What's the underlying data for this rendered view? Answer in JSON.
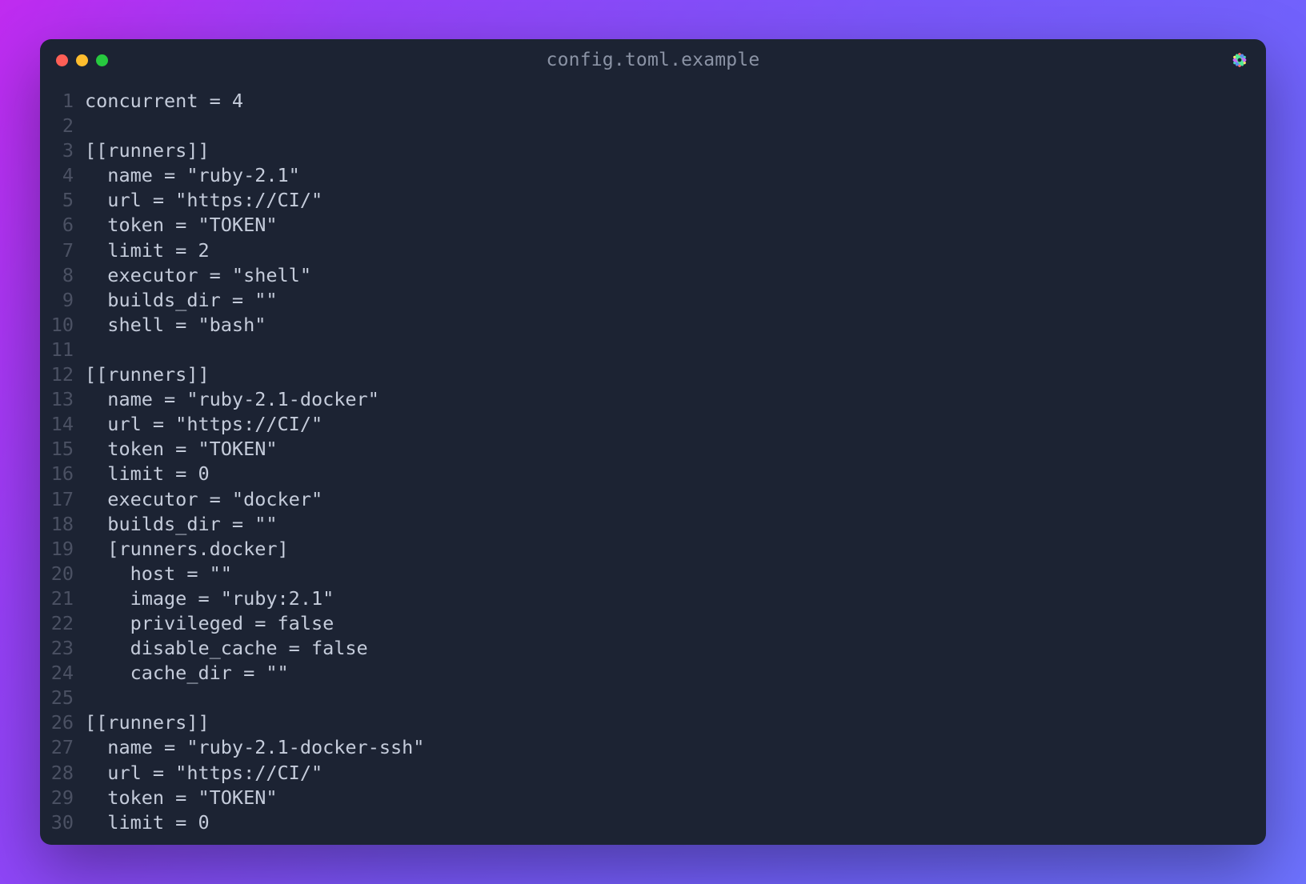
{
  "window": {
    "title": "config.toml.example"
  },
  "colors": {
    "bg": "#1c2333",
    "text": "#c5ccdb",
    "linenum": "#4b5163",
    "titletext": "#8b93a5"
  },
  "lines": [
    {
      "n": 1,
      "t": "concurrent = 4"
    },
    {
      "n": 2,
      "t": ""
    },
    {
      "n": 3,
      "t": "[[runners]]"
    },
    {
      "n": 4,
      "t": "  name = \"ruby-2.1\""
    },
    {
      "n": 5,
      "t": "  url = \"https://CI/\""
    },
    {
      "n": 6,
      "t": "  token = \"TOKEN\""
    },
    {
      "n": 7,
      "t": "  limit = 2"
    },
    {
      "n": 8,
      "t": "  executor = \"shell\""
    },
    {
      "n": 9,
      "t": "  builds_dir = \"\""
    },
    {
      "n": 10,
      "t": "  shell = \"bash\""
    },
    {
      "n": 11,
      "t": ""
    },
    {
      "n": 12,
      "t": "[[runners]]"
    },
    {
      "n": 13,
      "t": "  name = \"ruby-2.1-docker\""
    },
    {
      "n": 14,
      "t": "  url = \"https://CI/\""
    },
    {
      "n": 15,
      "t": "  token = \"TOKEN\""
    },
    {
      "n": 16,
      "t": "  limit = 0"
    },
    {
      "n": 17,
      "t": "  executor = \"docker\""
    },
    {
      "n": 18,
      "t": "  builds_dir = \"\""
    },
    {
      "n": 19,
      "t": "  [runners.docker]"
    },
    {
      "n": 20,
      "t": "    host = \"\""
    },
    {
      "n": 21,
      "t": "    image = \"ruby:2.1\""
    },
    {
      "n": 22,
      "t": "    privileged = false"
    },
    {
      "n": 23,
      "t": "    disable_cache = false"
    },
    {
      "n": 24,
      "t": "    cache_dir = \"\""
    },
    {
      "n": 25,
      "t": ""
    },
    {
      "n": 26,
      "t": "[[runners]]"
    },
    {
      "n": 27,
      "t": "  name = \"ruby-2.1-docker-ssh\""
    },
    {
      "n": 28,
      "t": "  url = \"https://CI/\""
    },
    {
      "n": 29,
      "t": "  token = \"TOKEN\""
    },
    {
      "n": 30,
      "t": "  limit = 0"
    }
  ]
}
